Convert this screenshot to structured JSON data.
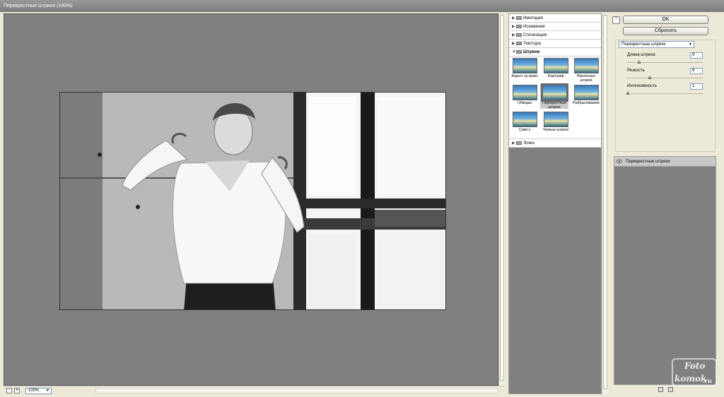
{
  "window": {
    "title": "Перекрестные штрихи (100%)"
  },
  "preview": {
    "zoom": "100%",
    "zoom_out_label": "-",
    "zoom_in_label": "+"
  },
  "gallery": {
    "categories_top": [
      {
        "label": "Имитация"
      },
      {
        "label": "Искажение"
      },
      {
        "label": "Стилизация"
      },
      {
        "label": "Текстура"
      }
    ],
    "open_category": {
      "label": "Штрихи"
    },
    "thumbnails": [
      {
        "label": "Акцент на краях"
      },
      {
        "label": "Аэрограф"
      },
      {
        "label": "Наклонные штрихи"
      },
      {
        "label": "Обводка"
      },
      {
        "label": "Перекрестные штрихи"
      },
      {
        "label": "Разбрызгивание"
      },
      {
        "label": "Суми-э"
      },
      {
        "label": "Темные штрихи"
      }
    ],
    "categories_bottom": [
      {
        "label": "Эскиз"
      }
    ]
  },
  "buttons": {
    "ok": "OK",
    "reset": "Сбросить"
  },
  "settings": {
    "filter_select": "Перекрестные штрихи",
    "params": [
      {
        "label": "Длина штриха",
        "value": "9",
        "level": 0.15
      },
      {
        "label": "Резкость",
        "value": "6",
        "level": 0.3
      },
      {
        "label": "Интенсивность",
        "value": "1",
        "level": 0.0
      }
    ]
  },
  "layers": {
    "items": [
      {
        "label": "Перекрестные штрихи"
      }
    ]
  },
  "watermark": {
    "line1": "Foto",
    "line2": "komok",
    "line3": ".ru"
  },
  "colors": {
    "canvas": "#808080",
    "panel": "#ece9d8",
    "selected_thumb": "#c9c9c9"
  }
}
